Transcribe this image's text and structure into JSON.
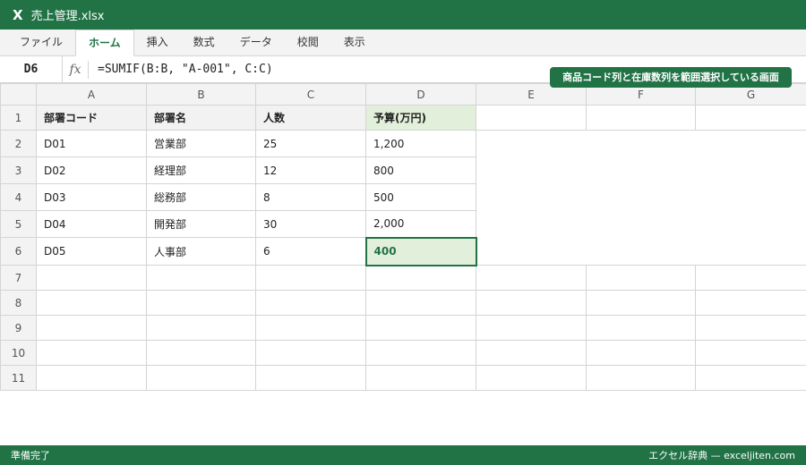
{
  "titlebar": {
    "app_icon": "X",
    "filename": "売上管理.xlsx"
  },
  "ribbon": {
    "tabs": [
      "ファイル",
      "ホーム",
      "挿入",
      "数式",
      "データ",
      "校閲",
      "表示"
    ],
    "active_tab": "ホーム"
  },
  "formula_bar": {
    "cell_ref": "D6",
    "fx_label": "fx",
    "formula": "=SUMIF(B:B, \"A-001\", C:C)"
  },
  "callout": "商品コード列と在庫数列を範囲選択している画面",
  "sheet": {
    "columns": [
      "A",
      "B",
      "C",
      "D",
      "E",
      "F",
      "G"
    ],
    "rows": [
      "1",
      "2",
      "3",
      "4",
      "5",
      "6",
      "7",
      "8",
      "9",
      "10",
      "11"
    ],
    "headers": [
      "部署コード",
      "部署名",
      "人数",
      "予算(万円)"
    ],
    "data": [
      [
        "D01",
        "営業部",
        "25",
        "1,200"
      ],
      [
        "D02",
        "経理部",
        "12",
        "800"
      ],
      [
        "D03",
        "総務部",
        "8",
        "500"
      ],
      [
        "D04",
        "開発部",
        "30",
        "2,000"
      ],
      [
        "D05",
        "人事部",
        "6",
        "400"
      ]
    ],
    "selected_cell": "D6"
  },
  "status": {
    "left": "準備完了",
    "right": "エクセル辞典 — exceljiten.com"
  },
  "colors": {
    "brand": "#217346",
    "selected_fill": "#e2efda",
    "grid": "#d4d4d4"
  }
}
